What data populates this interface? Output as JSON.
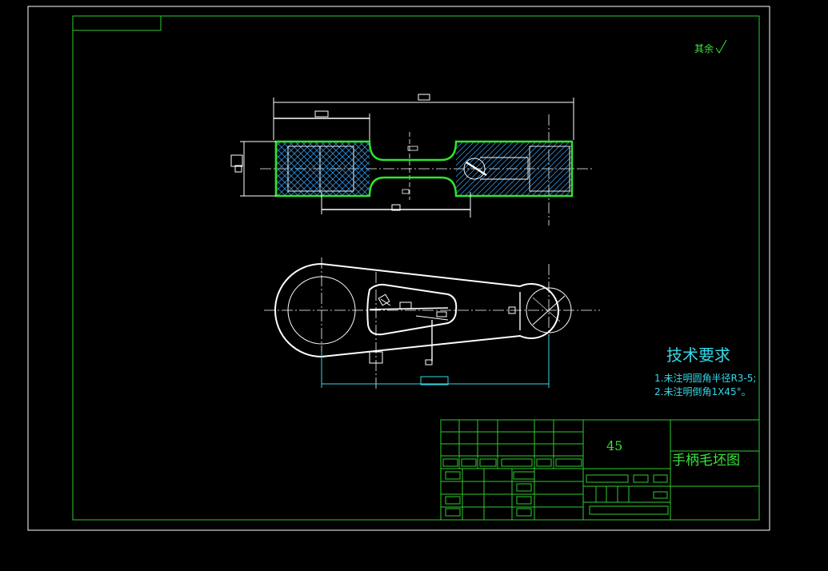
{
  "drawing": {
    "surface_note": "其余",
    "material": "45",
    "title": "手柄毛坯图"
  },
  "tech_requirements": {
    "heading": "技术要求",
    "items": [
      "1.未注明圆角半径R3-5;",
      "2.未注明倒角1X45°。"
    ]
  },
  "colors": {
    "background": "#000000",
    "frame": "#ffffff",
    "border": "#2ecc2e",
    "outline": "#ffffff",
    "highlight": "#2ee62e",
    "hatch": "#40b0ff",
    "dimension": "#35d9e8",
    "text": "#37e637"
  }
}
